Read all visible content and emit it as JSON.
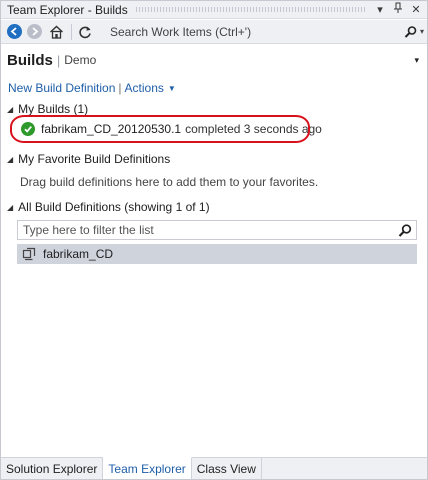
{
  "window": {
    "title": "Team Explorer - Builds",
    "dropdown_glyph": "▾",
    "pin_glyph": "⊣",
    "close_glyph": "✕"
  },
  "toolbar": {
    "search_placeholder": "Search Work Items (Ctrl+')",
    "search_dropdown_glyph": "▾"
  },
  "page": {
    "title": "Builds",
    "divider": "|",
    "subtitle": "Demo",
    "menu_glyph": "▾"
  },
  "actions": {
    "new_build_definition": "New Build Definition",
    "separator": "|",
    "actions_label": "Actions",
    "caret": "▼"
  },
  "sections": {
    "my_builds": {
      "title": "My Builds (1)",
      "builds": [
        {
          "name": "fabrikam_CD_20120530.1",
          "status": "completed 3 seconds ago"
        }
      ]
    },
    "favorites": {
      "title": "My Favorite Build Definitions",
      "hint": "Drag build definitions here to add them to your favorites."
    },
    "all_definitions": {
      "title": "All Build Definitions (showing 1 of 1)",
      "filter_placeholder": "Type here to filter the list",
      "items": [
        {
          "name": "fabrikam_CD"
        }
      ]
    },
    "collapse_glyph": "◢"
  },
  "bottom_tabs": [
    {
      "label": "Solution Explorer",
      "active": false
    },
    {
      "label": "Team Explorer",
      "active": true
    },
    {
      "label": "Class View",
      "active": false
    }
  ],
  "colors": {
    "accent_link": "#1f5fa8",
    "success": "#2e9a2b",
    "highlight_oval": "#d8121c",
    "selected_row": "#cfd3dc"
  }
}
